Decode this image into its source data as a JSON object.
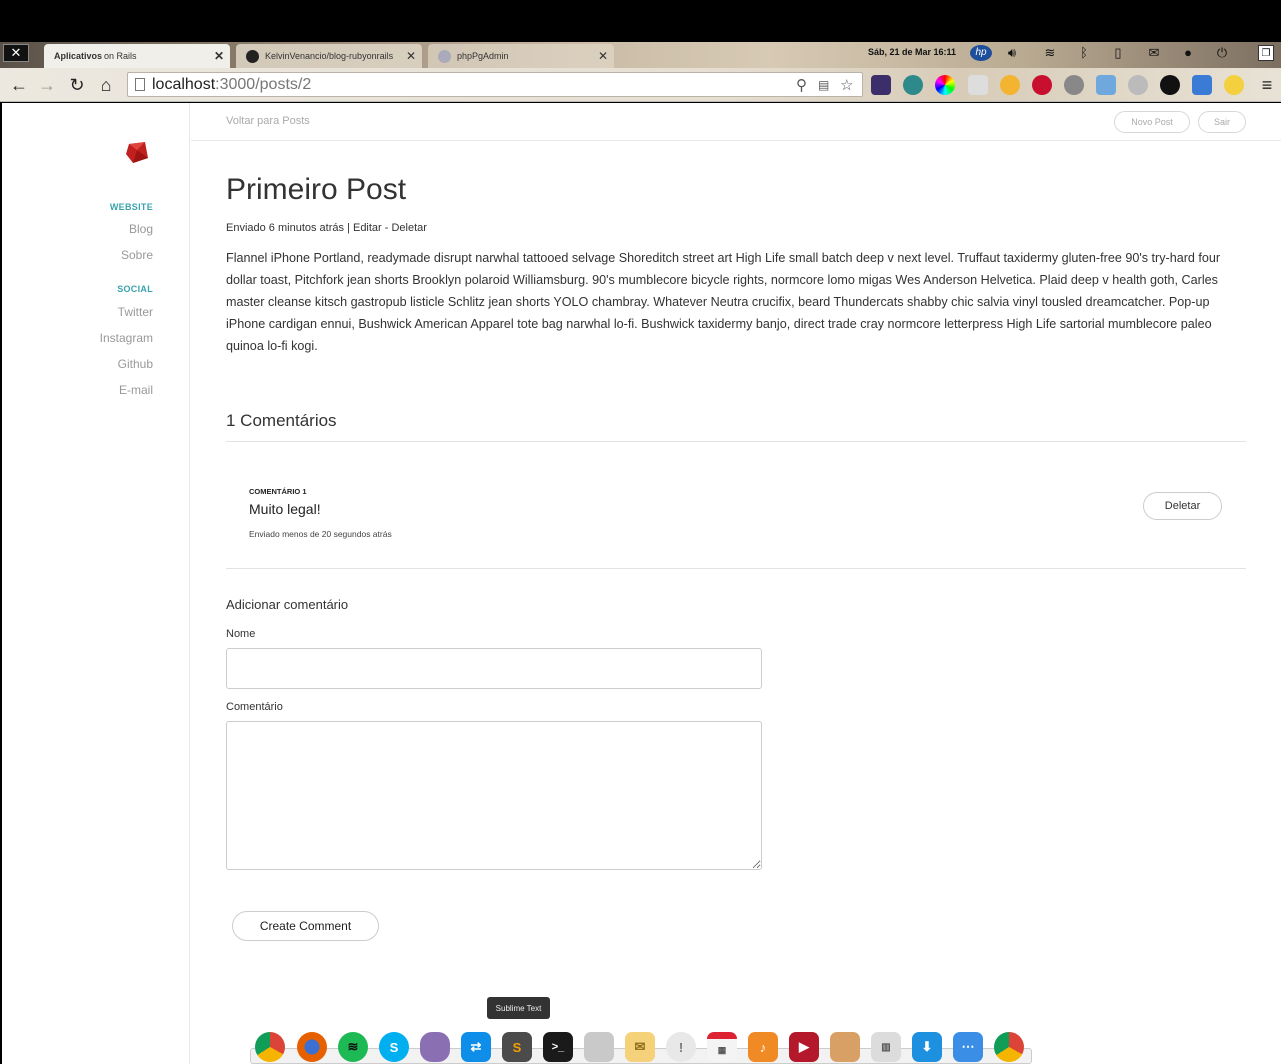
{
  "browser": {
    "tabs": [
      {
        "label": "Aplicativos",
        "sublabel": "on Rails",
        "active": true
      },
      {
        "label": "KelvinVenancio/blog-rubyonrails",
        "active": false
      },
      {
        "label": "phpPgAdmin",
        "active": false
      }
    ],
    "url_host": "localhost",
    "url_rest": ":3000/posts/2",
    "clock": "Sáb, 21 de Mar 16:11"
  },
  "sidebar": {
    "website_heading": "WEBSITE",
    "website_links": [
      "Blog",
      "Sobre"
    ],
    "social_heading": "SOCIAL",
    "social_links": [
      "Twitter",
      "Instagram",
      "Github",
      "E-mail"
    ]
  },
  "topnav": {
    "back_label": "Voltar para Posts",
    "new_post_label": "Novo Post",
    "logout_label": "Sair"
  },
  "post": {
    "title": "Primeiro Post",
    "meta": "Enviado 6 minutos atrás | Editar - Deletar",
    "body": "Flannel iPhone Portland, readymade disrupt narwhal tattooed selvage Shoreditch street art High Life small batch deep v next level. Truffaut taxidermy gluten-free 90's try-hard four dollar toast, Pitchfork jean shorts Brooklyn polaroid Williamsburg. 90's mumblecore bicycle rights, normcore lomo migas Wes Anderson Helvetica. Plaid deep v health goth, Carles master cleanse kitsch gastropub listicle Schlitz jean shorts YOLO chambray. Whatever Neutra crucifix, beard Thundercats shabby chic salvia vinyl tousled dreamcatcher. Pop-up iPhone cardigan ennui, Bushwick American Apparel tote bag narwhal lo-fi. Bushwick taxidermy banjo, direct trade cray normcore letterpress High Life sartorial mumblecore paleo quinoa lo-fi kogi."
  },
  "comments": {
    "heading": "1 Comentários",
    "items": [
      {
        "label": "COMENTÁRIO 1",
        "body": "Muito legal!",
        "time": "Enviado menos de 20 segundos atrás",
        "delete_label": "Deletar"
      }
    ]
  },
  "form": {
    "heading": "Adicionar comentário",
    "name_label": "Nome",
    "name_value": "",
    "comment_label": "Comentário",
    "comment_value": "",
    "submit_label": "Create Comment"
  },
  "dock": {
    "tooltip": "Sublime Text",
    "icons": [
      "chrome-icon",
      "firefox-icon",
      "spotify-icon",
      "skype-icon",
      "pidgin-icon",
      "teamviewer-icon",
      "sublime-text-icon",
      "terminal-icon",
      "files-icon",
      "mail-icon",
      "notifications-icon",
      "calendar-icon",
      "music-icon",
      "video-icon",
      "photos-icon",
      "workspaces-icon",
      "downloads-icon",
      "apps-icon",
      "chrome-icon-2"
    ]
  },
  "colors": {
    "accent": "#3aa3ad",
    "ruby": "#c0201e"
  }
}
